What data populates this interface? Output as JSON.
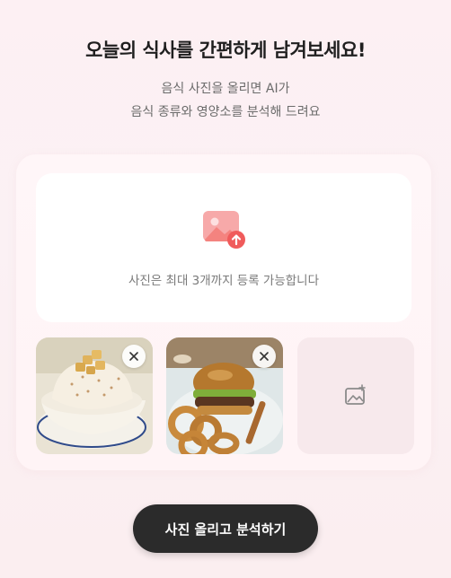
{
  "header": {
    "title": "오늘의 식사를 간편하게 남겨보세요!",
    "subtitle_line1": "음식 사진을 올리면 AI가",
    "subtitle_line2": "음식 종류와 영양소를 분석해 드려요"
  },
  "upload": {
    "icon": "image-upload-icon",
    "hint": "사진은 최대 3개까지 등록 가능합니다"
  },
  "photos": [
    {
      "subject": "shaved-ice-dessert",
      "remove_icon": "close-icon"
    },
    {
      "subject": "burger-with-onion-rings",
      "remove_icon": "close-icon"
    }
  ],
  "empty_slot": {
    "icon": "add-photo-icon"
  },
  "actions": {
    "submit_label": "사진 올리고 분석하기"
  },
  "colors": {
    "accent": "#f26b6b",
    "button_bg": "#2b2b2b",
    "background": "#fdf0f3"
  }
}
